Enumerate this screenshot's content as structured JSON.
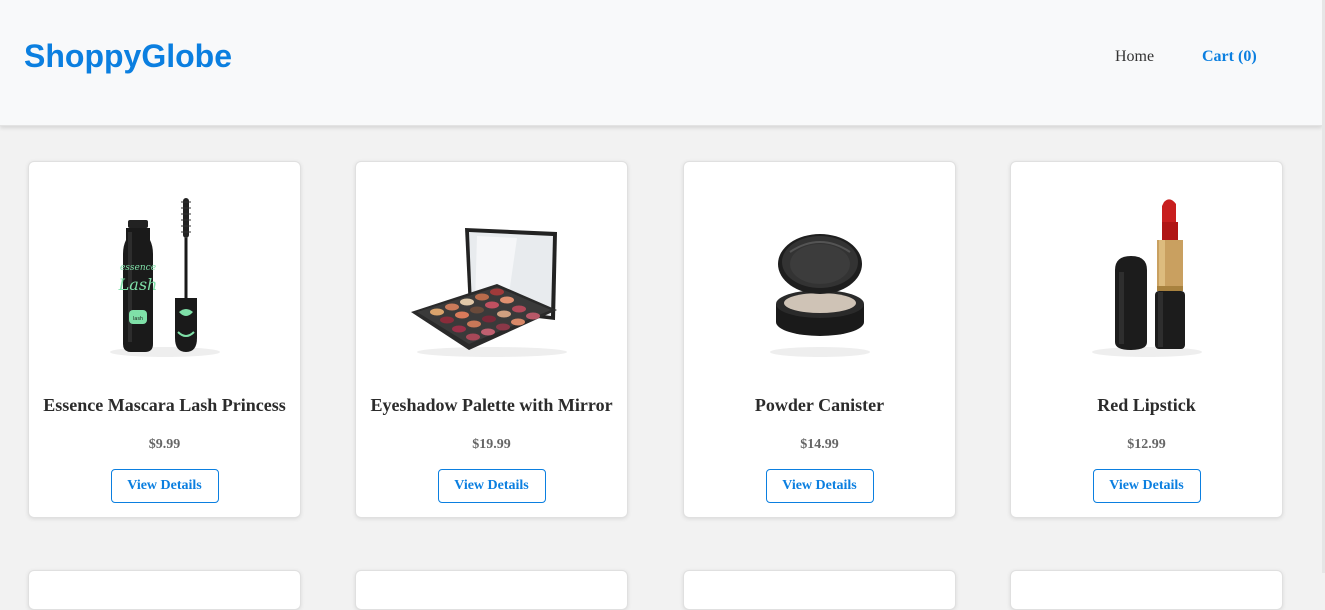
{
  "header": {
    "logo": "ShoppyGlobe",
    "nav": {
      "home": "Home",
      "cart": "Cart (0)"
    }
  },
  "products": [
    {
      "title": "Essence Mascara Lash Princess",
      "price": "$9.99",
      "button": "View Details",
      "image_icon": "mascara-icon"
    },
    {
      "title": "Eyeshadow Palette with Mirror",
      "price": "$19.99",
      "button": "View Details",
      "image_icon": "eyeshadow-palette-icon"
    },
    {
      "title": "Powder Canister",
      "price": "$14.99",
      "button": "View Details",
      "image_icon": "powder-compact-icon"
    },
    {
      "title": "Red Lipstick",
      "price": "$12.99",
      "button": "View Details",
      "image_icon": "lipstick-icon"
    }
  ],
  "colors": {
    "brand": "#0b7fe0",
    "page_bg": "#f2f2f2",
    "header_bg": "#f8f9fa"
  }
}
